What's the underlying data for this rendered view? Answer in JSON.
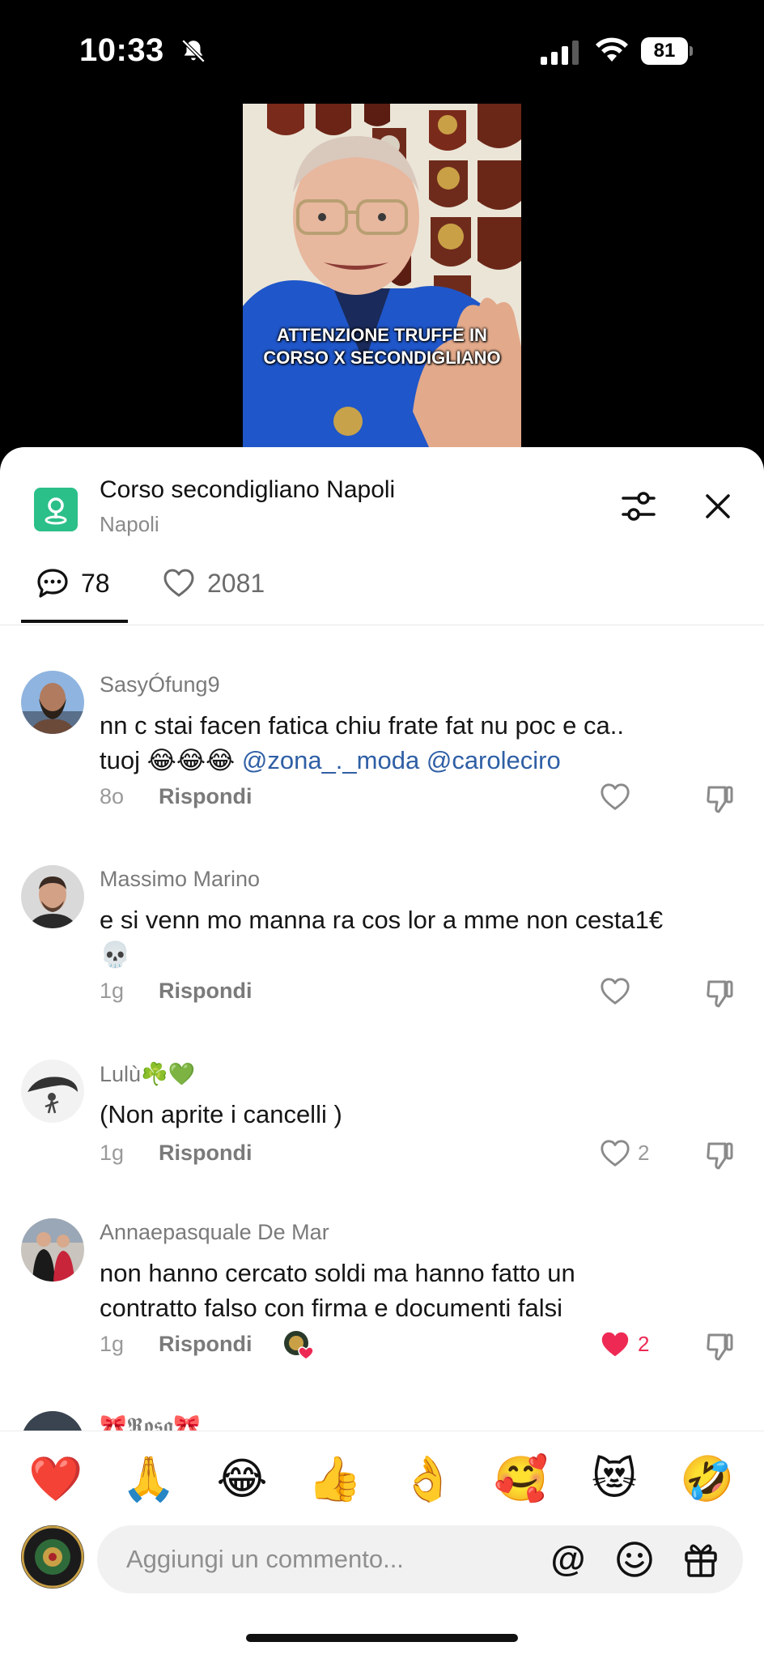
{
  "status_bar": {
    "time": "10:33",
    "battery": "81",
    "icons": [
      "bell-off-icon",
      "signal-icon",
      "wifi-icon",
      "battery-icon"
    ]
  },
  "video": {
    "caption_line1": "ATTENZIONE TRUFFE IN",
    "caption_line2": "CORSO X SECONDIGLIANO"
  },
  "location": {
    "title": "Corso secondigliano Napoli",
    "subtitle": "Napoli",
    "accent": "#2bbf89"
  },
  "tabs": {
    "comments_count": "78",
    "likes_count": "2081"
  },
  "comments": [
    {
      "user": "SasyÓfung9",
      "text_plain": "nn c stai facen fatica chiu frate fat nu poc e ca..",
      "text_line2": "tuoj 😂😂😂 ",
      "mentions": [
        "@zona_._moda",
        "@caroleciro"
      ],
      "time": "8o",
      "reply": "Rispondi",
      "likes": ""
    },
    {
      "user": "Massimo Marino",
      "text": "e si venn mo manna ra cos lor a mme non cesta1€",
      "text_line2": "💀",
      "time": "1g",
      "reply": "Rispondi",
      "likes": ""
    },
    {
      "user": "Lulù☘️💚",
      "text": "(Non aprite i cancelli )",
      "time": "1g",
      "reply": "Rispondi",
      "likes": "2"
    },
    {
      "user": "Annaepasquale De Mar",
      "text": "non hanno cercato soldi ma hanno fatto un",
      "text_line2": "contratto falso con firma e documenti falsi",
      "time": "1g",
      "reply": "Rispondi",
      "likes": "2",
      "liked": true
    },
    {
      "user": "🎀𝕽𝖔𝖘𝖆🎀"
    }
  ],
  "quick_emojis": [
    "❤️",
    "🙏",
    "😂",
    "👍",
    "👌",
    "🥰",
    "😻",
    "🤣"
  ],
  "composer": {
    "placeholder": "Aggiungi un commento..."
  }
}
